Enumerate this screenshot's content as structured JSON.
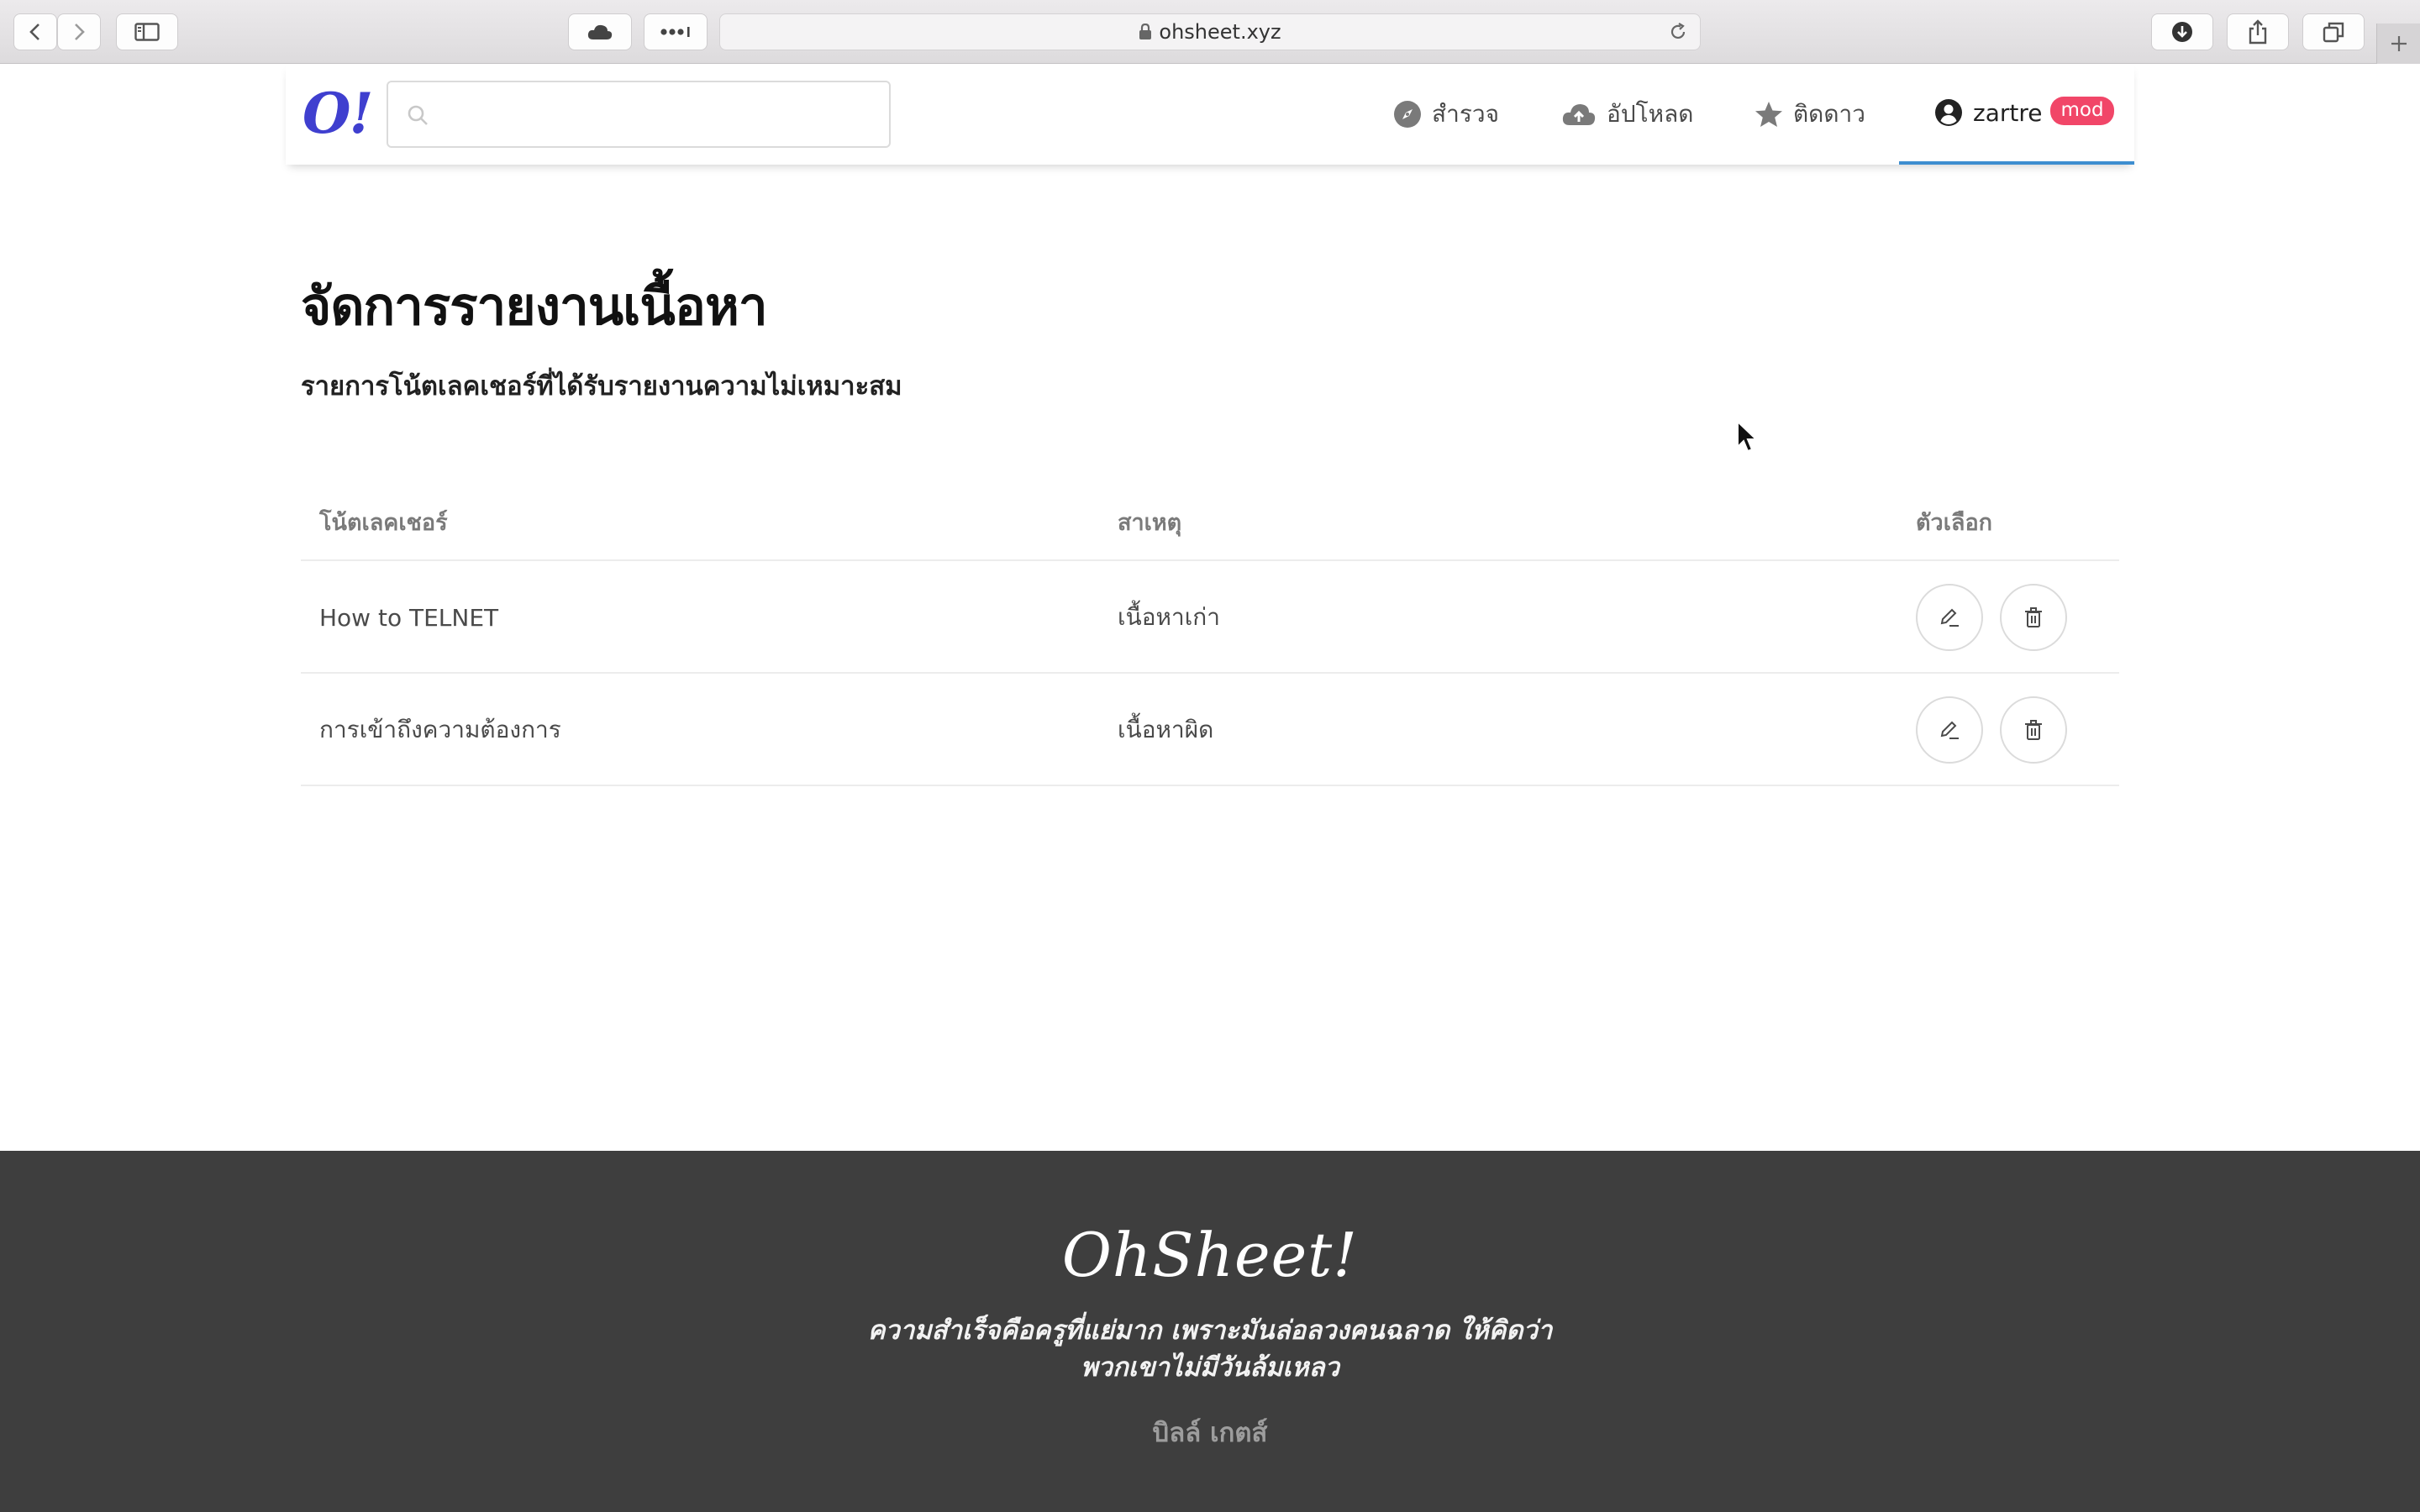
{
  "browser": {
    "url": "ohsheet.xyz"
  },
  "nav": {
    "logo": "O!",
    "search_placeholder": "",
    "explore": "สำรวจ",
    "upload": "อัปโหลด",
    "starred": "ติดดาว",
    "username": "zartre",
    "role_badge": "mod"
  },
  "page": {
    "title": "จัดการรายงานเนื้อหา",
    "subtitle": "รายการโน้ตเลคเชอร์ที่ได้รับรายงานความไม่เหมาะสม"
  },
  "table": {
    "headers": [
      "โน้ตเลคเชอร์",
      "สาเหตุ",
      "ตัวเลือก"
    ],
    "rows": [
      {
        "note": "How to TELNET",
        "reason": "เนื้อหาเก่า"
      },
      {
        "note": "การเข้าถึงความต้องการ",
        "reason": "เนื้อหาผิด"
      }
    ]
  },
  "footer": {
    "brand": "OhSheet!",
    "quote_line1": "ความสำเร็จคือครูที่แย่มาก เพราะมันล่อลวงคนฉลาด ให้คิดว่า",
    "quote_line2": "พวกเขาไม่มีวันล้มเหลว",
    "author": "บิลล์ เกตส์"
  },
  "colors": {
    "logo": "#3f3fcf",
    "badge": "#f14668",
    "active_underline": "#3e8ed0",
    "footer_bg": "#3e3e3e"
  },
  "icons": {
    "explore": "compass-icon",
    "upload": "cloud-upload-icon",
    "starred": "star-icon",
    "user": "user-circle-icon",
    "edit": "pencil-icon",
    "delete": "trash-icon"
  }
}
